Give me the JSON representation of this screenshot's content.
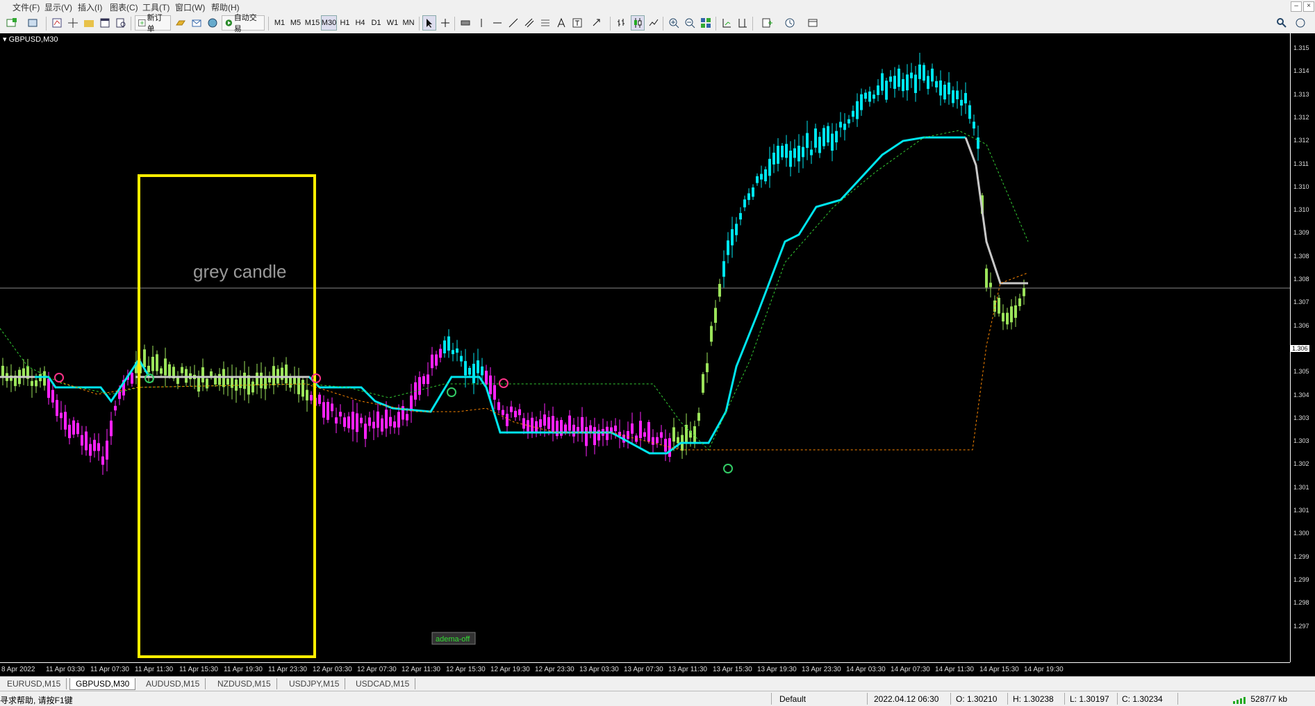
{
  "menu": [
    "文件(F)",
    "显示(V)",
    "插入(I)",
    "图表(C)",
    "工具(T)",
    "窗口(W)",
    "帮助(H)"
  ],
  "toolbar": {
    "new_order": "新订单",
    "auto_trading": "自动交易",
    "timeframes": [
      "M1",
      "M5",
      "M15",
      "M30",
      "H1",
      "H4",
      "D1",
      "W1",
      "MN"
    ],
    "active_timeframe": "M30"
  },
  "chart": {
    "title": "GBPUSD,M30",
    "annotation": "grey candle",
    "label_box": "adema-off",
    "current_price": "1.306",
    "price_levels": [
      "1.315",
      "1.314",
      "1.313",
      "1.312",
      "1.312",
      "1.311",
      "1.310",
      "1.310",
      "1.309",
      "1.308",
      "1.308",
      "1.307",
      "1.306",
      "1.305",
      "1.305",
      "1.304",
      "1.303",
      "1.303",
      "1.302",
      "1.301",
      "1.301",
      "1.300",
      "1.299",
      "1.299",
      "1.298",
      "1.297"
    ],
    "time_labels": [
      "8 Apr 2022",
      "11 Apr 03:30",
      "11 Apr 07:30",
      "11 Apr 11:30",
      "11 Apr 15:30",
      "11 Apr 19:30",
      "11 Apr 23:30",
      "12 Apr 03:30",
      "12 Apr 07:30",
      "12 Apr 11:30",
      "12 Apr 15:30",
      "12 Apr 19:30",
      "12 Apr 23:30",
      "13 Apr 03:30",
      "13 Apr 07:30",
      "13 Apr 11:30",
      "13 Apr 15:30",
      "13 Apr 19:30",
      "13 Apr 23:30",
      "14 Apr 03:30",
      "14 Apr 07:30",
      "14 Apr 11:30",
      "14 Apr 15:30",
      "14 Apr 19:30"
    ],
    "colors": {
      "background": "#000000",
      "bull_cyan": "#00e5ee",
      "bear_magenta": "#ff22ff",
      "neutral_green": "#9be35a",
      "grey": "#c8c8c8",
      "box": "#ffee00"
    }
  },
  "tabs": [
    "EURUSD,M15",
    "GBPUSD,M30",
    "AUDUSD,M15",
    "NZDUSD,M15",
    "USDJPY,M15",
    "USDCAD,M15"
  ],
  "active_tab": "GBPUSD,M30",
  "status": {
    "help": "寻求帮助, 请按F1键",
    "profile": "Default",
    "datetime": "2022.04.12 06:30",
    "open": "O: 1.30210",
    "high": "H: 1.30238",
    "low": "L: 1.30197",
    "close": "C: 1.30234",
    "traffic": "5287/7 kb"
  }
}
